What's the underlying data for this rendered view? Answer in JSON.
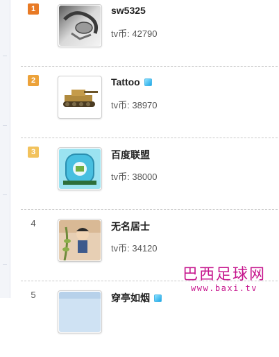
{
  "coin_label": "tv币:",
  "ranking": [
    {
      "rank": "1",
      "name": "sw5325",
      "vip": false,
      "coins": "42790",
      "avatar_icon": "metal-figure-avatar-icon"
    },
    {
      "rank": "2",
      "name": "Tattoo",
      "vip": true,
      "coins": "38970",
      "avatar_icon": "tank-avatar-icon"
    },
    {
      "rank": "3",
      "name": "百度联盟",
      "vip": false,
      "coins": "38000",
      "avatar_icon": "blue-mascot-avatar-icon"
    },
    {
      "rank": "4",
      "name": "无名居士",
      "vip": false,
      "coins": "34120",
      "avatar_icon": "cartoon-boy-avatar-icon"
    },
    {
      "rank": "5",
      "name": "穿亭如烟",
      "vip": true,
      "coins": "",
      "avatar_icon": "sky-avatar-icon"
    }
  ],
  "watermark": {
    "title": "巴西足球网",
    "url": "www.baxi.tv"
  },
  "colors": {
    "rank1": "#e87a25",
    "rank2": "#eca23a",
    "rank3": "#f2c25c",
    "watermark": "#c6168d"
  }
}
